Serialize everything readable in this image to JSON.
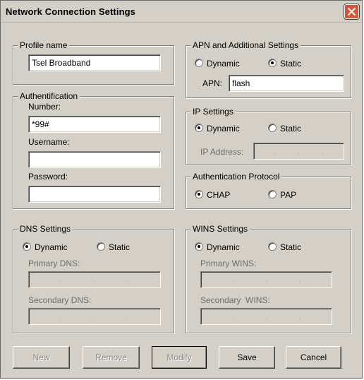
{
  "window": {
    "title": "Network Connection Settings",
    "close_icon": "close-icon"
  },
  "profile": {
    "legend": "Profile name",
    "value": "Tsel Broadband"
  },
  "auth": {
    "legend": "Authentification",
    "number_label": "Number:",
    "number_value": "*99#",
    "username_label": "Username:",
    "username_value": "",
    "password_label": "Password:",
    "password_value": ""
  },
  "dns": {
    "legend": "DNS Settings",
    "dynamic_label": "Dynamic",
    "static_label": "Static",
    "selected": "Dynamic",
    "primary_label": "Primary DNS:",
    "secondary_label": "Secondary DNS:"
  },
  "apn": {
    "legend": "APN and Additional Settings",
    "dynamic_label": "Dynamic",
    "static_label": "Static",
    "selected": "Static",
    "apn_label": "APN:",
    "apn_value": "flash"
  },
  "ip": {
    "legend": "IP Settings",
    "dynamic_label": "Dynamic",
    "static_label": "Static",
    "selected": "Dynamic",
    "address_label": "IP Address:"
  },
  "auth_protocol": {
    "legend": "Authentication Protocol",
    "chap_label": "CHAP",
    "pap_label": "PAP",
    "selected": "CHAP"
  },
  "wins": {
    "legend": "WINS Settings",
    "dynamic_label": "Dynamic",
    "static_label": "Static",
    "selected": "Dynamic",
    "primary_label": "Primary WINS:",
    "secondary_label": "Secondary  WINS:"
  },
  "buttons": {
    "new": "New",
    "remove": "Remove",
    "modify": "Modify",
    "save": "Save",
    "cancel": "Cancel"
  },
  "colors": {
    "dialog_bg": "#d4d0c8",
    "close_button": "#d7563b",
    "disabled_text": "#8a8a8a"
  }
}
